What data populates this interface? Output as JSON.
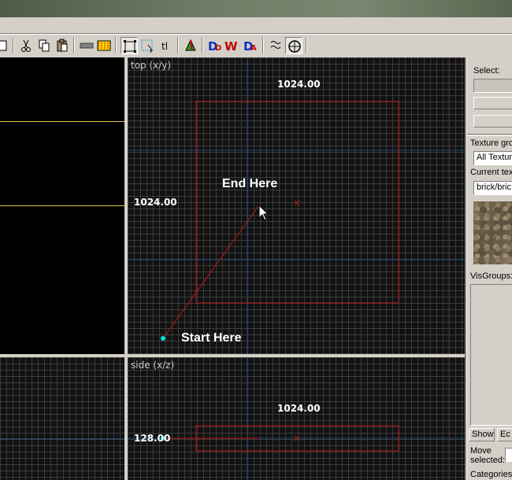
{
  "toolbar": {
    "icons": [
      "open-icon",
      "cut-icon",
      "copy-icon",
      "paste-icon",
      "group-icon",
      "hide-icon",
      "selection-box-icon",
      "texture-lock-icon",
      "toggle-text-icon",
      "carve-icon",
      "display-models-icon",
      "vertex-icon",
      "vertex-manipulation-icon",
      "snap-icon",
      "cordon-icon"
    ],
    "tl_label": "tl"
  },
  "viewports": {
    "top": {
      "label": "top (x/y)",
      "width_label": "1024.00",
      "height_label": "1024.00"
    },
    "side": {
      "label": "side (x/z)",
      "width_label": "1024.00",
      "height_label": "128.00"
    }
  },
  "annotations": {
    "start": "Start Here",
    "end": "End Here"
  },
  "panel": {
    "select_label": "Select:",
    "texture_group_label": "Texture gro",
    "texture_group_value": "All Textur",
    "current_texture_label": "Current text",
    "current_texture_value": "brick/bric",
    "visgroups_label": "VisGroups:",
    "show_button": "Show",
    "edit_button": "Ec",
    "move_selected_label_1": "Move",
    "move_selected_label_2": "selected:",
    "categories_label": "Categories:"
  },
  "colors": {
    "brush_outline": "#c01818",
    "center_mark": "#c01818",
    "point": "#00e0e0",
    "yellow_line": "#d8c848",
    "axis_blue": "#1e4a7a"
  }
}
